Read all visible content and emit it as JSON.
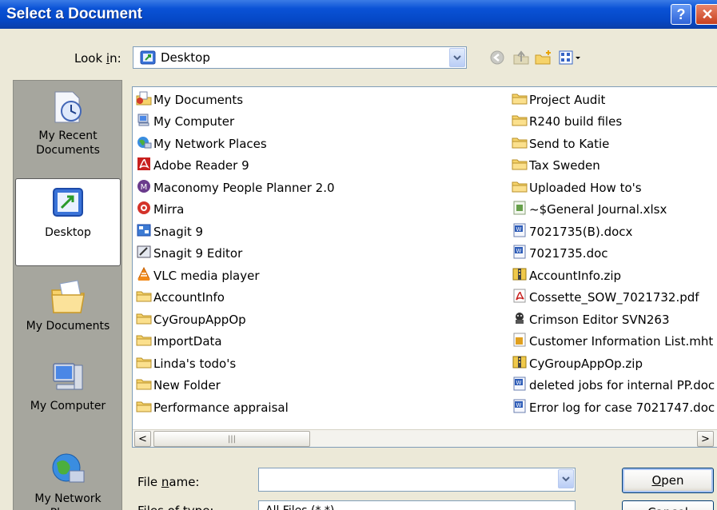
{
  "window": {
    "title": "Select a Document",
    "help_label": "?",
    "close_label": "✕"
  },
  "lookin": {
    "label_pre": "Look ",
    "label_accel": "i",
    "label_post": "n:",
    "value": "Desktop"
  },
  "places": [
    {
      "label": "My Recent Documents",
      "icon": "recent-documents-icon"
    },
    {
      "label": "Desktop",
      "icon": "desktop-icon",
      "selected": true
    },
    {
      "label": "My Documents",
      "icon": "my-documents-icon"
    },
    {
      "label": "My Computer",
      "icon": "my-computer-icon"
    },
    {
      "label": "My Network Places",
      "icon": "network-places-icon"
    }
  ],
  "files_left": [
    {
      "label": "My Documents",
      "icon": "my-documents"
    },
    {
      "label": "My Computer",
      "icon": "computer"
    },
    {
      "label": "My Network Places",
      "icon": "network"
    },
    {
      "label": "Adobe Reader 9",
      "icon": "adobe"
    },
    {
      "label": "Maconomy People Planner 2.0",
      "icon": "maconomy"
    },
    {
      "label": "Mirra",
      "icon": "mirra"
    },
    {
      "label": "Snagit 9",
      "icon": "snagit"
    },
    {
      "label": "Snagit 9 Editor",
      "icon": "snagit-editor"
    },
    {
      "label": "VLC media player",
      "icon": "vlc"
    },
    {
      "label": "AccountInfo",
      "icon": "folder"
    },
    {
      "label": "CyGroupAppOp",
      "icon": "folder"
    },
    {
      "label": "ImportData",
      "icon": "folder"
    },
    {
      "label": "Linda's todo's",
      "icon": "folder"
    },
    {
      "label": "New Folder",
      "icon": "folder"
    },
    {
      "label": "Performance appraisal",
      "icon": "folder"
    }
  ],
  "files_right": [
    {
      "label": "Project Audit",
      "icon": "folder"
    },
    {
      "label": "R240 build files",
      "icon": "folder"
    },
    {
      "label": "Send to Katie",
      "icon": "folder"
    },
    {
      "label": "Tax Sweden",
      "icon": "folder"
    },
    {
      "label": "Uploaded How to's",
      "icon": "folder"
    },
    {
      "label": "~$General Journal.xlsx",
      "icon": "excel"
    },
    {
      "label": "7021735(B).docx",
      "icon": "word"
    },
    {
      "label": "7021735.doc",
      "icon": "word"
    },
    {
      "label": "AccountInfo.zip",
      "icon": "zip"
    },
    {
      "label": "Cossette_SOW_7021732.pdf",
      "icon": "pdf"
    },
    {
      "label": "Crimson Editor SVN263",
      "icon": "crimson"
    },
    {
      "label": "Customer Information List.mht",
      "icon": "mht"
    },
    {
      "label": "CyGroupAppOp.zip",
      "icon": "zip"
    },
    {
      "label": "deleted jobs for internal PP.doc",
      "icon": "word"
    },
    {
      "label": "Error log for case 7021747.doc",
      "icon": "word"
    }
  ],
  "scrollbar": {
    "left_arrow": "<",
    "right_arrow": ">",
    "thumb_grip": "|||"
  },
  "bottom": {
    "filename_label_pre": "File ",
    "filename_label_accel": "n",
    "filename_label_post": "ame:",
    "filename_value": "",
    "open_accel": "O",
    "open_rest": "pen",
    "filetype_label": "Files of type:",
    "filetype_value": "All Files (*.*)",
    "cancel_label": "Cancel"
  }
}
